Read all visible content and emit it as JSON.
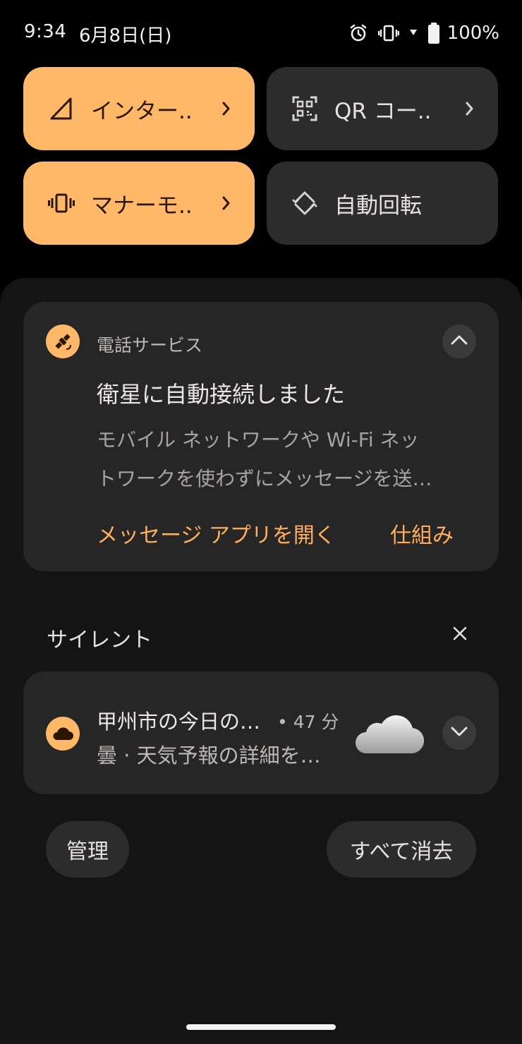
{
  "status_bar": {
    "time": "9:34",
    "date": "6月8日(日)",
    "battery_percent": "100%",
    "icons": [
      "alarm-icon",
      "vibrate-icon",
      "wifi-charging-icon",
      "battery-full-icon"
    ]
  },
  "quick_tiles": [
    {
      "label": "インター..",
      "icon": "signal-icon",
      "active": true,
      "has_chevron": true
    },
    {
      "label": "QR コー..",
      "icon": "qr-code-icon",
      "active": false,
      "has_chevron": true
    },
    {
      "label": "マナーモ..",
      "icon": "vibrate-icon",
      "active": true,
      "has_chevron": true
    },
    {
      "label": "自動回転",
      "icon": "rotate-icon",
      "active": false,
      "has_chevron": false
    }
  ],
  "satellite_notification": {
    "app_name": "電話サービス",
    "app_icon": "satellite-icon",
    "title": "衛星に自動接続しました",
    "body_line1": "モバイル ネットワークや Wi-Fi ネッ",
    "body_line2": "トワークを使わずにメッセージを送…",
    "action_open": "メッセージ アプリを開く",
    "action_how": "仕組み"
  },
  "silent_section": {
    "header": "サイレント",
    "weather_notification": {
      "app_icon": "cloud-icon",
      "title": "甲州市の今日の…",
      "time": "• 47 分",
      "body": "曇 · 天気予報の詳細を…"
    }
  },
  "footer": {
    "manage_label": "管理",
    "clear_all_label": "すべて消去"
  },
  "colors": {
    "accent": "#ffb868",
    "action_text": "#ffae5e",
    "card_bg": "#262626",
    "shade_bg": "#141414"
  }
}
